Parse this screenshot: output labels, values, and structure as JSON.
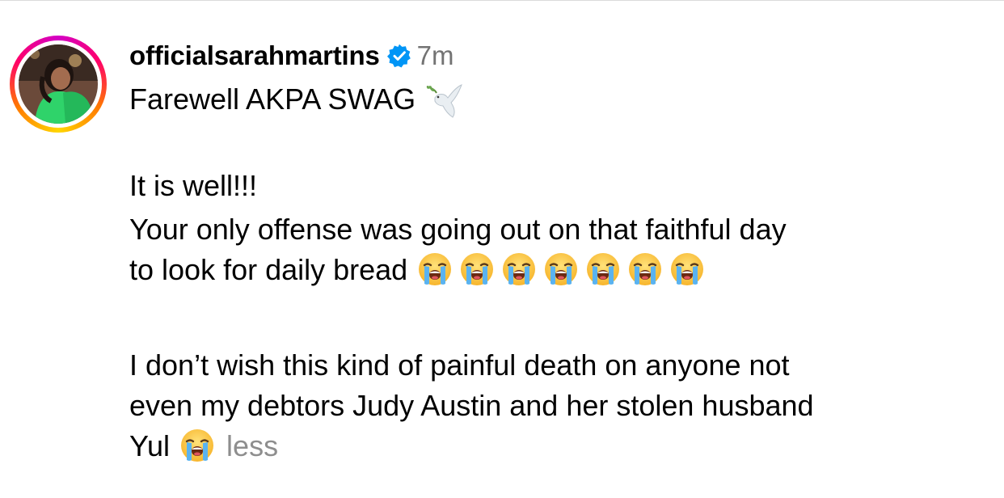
{
  "post": {
    "username": "officialsarahmartins",
    "verified_icon": "verified-badge-icon",
    "timestamp": "7m",
    "avatar_icon": "profile-avatar",
    "caption": {
      "line1": "Farewell AKPA SWAG",
      "line2": "It is well!!!",
      "line3": "Your only offense was going out on that faithful day",
      "line4": "to look for daily bread",
      "line5": "I don’t wish this kind of painful death on anyone not",
      "line6": "even my debtors Judy Austin and her stolen husband",
      "line7": "Yul"
    },
    "less_label": "less",
    "emoji": {
      "dove": "dove-emoji",
      "crying": "loudly-crying-emoji",
      "crying_count_line4": 7,
      "crying_count_line7": 1
    }
  },
  "colors": {
    "text": "#000000",
    "muted": "#737373",
    "less": "#8e8e8e",
    "verified_blue": "#0095f6",
    "story_ring": [
      "#d300c5",
      "#ff0069",
      "#ff7a00",
      "#ffd600"
    ]
  }
}
